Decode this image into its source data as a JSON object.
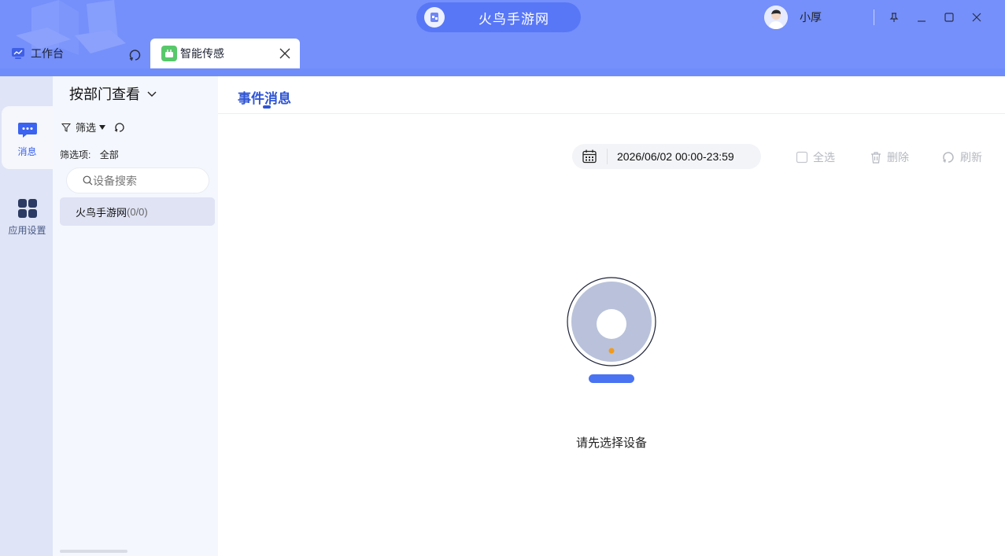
{
  "window": {
    "app_name": "火鸟手游网",
    "user_name": "小厚"
  },
  "tabs": [
    {
      "label": "工作台",
      "icon": "monitor-icon",
      "active": false
    },
    {
      "label": "智能传感",
      "icon": "sensor-app-icon",
      "active": true
    }
  ],
  "rail": {
    "items": [
      {
        "label": "消息",
        "icon": "message-icon",
        "active": true
      },
      {
        "label": "应用设置",
        "icon": "apps-grid-icon",
        "active": false
      }
    ]
  },
  "device_panel": {
    "group_by": "按部门查看",
    "filter_label": "筛选",
    "filter_items_label": "筛选项:",
    "filter_items_value": "全部",
    "search_placeholder": "设备搜索",
    "tree": [
      {
        "name": "火鸟手游网",
        "count": "(0/0)"
      }
    ]
  },
  "main": {
    "title": "事件消息",
    "date_range": "2026/06/02 00:00-23:59",
    "actions": {
      "select_all": "全选",
      "delete": "删除",
      "refresh": "刷新"
    },
    "empty_text": "请先选择设备"
  },
  "colors": {
    "titlebar": "#7590fb",
    "accent": "#2f55d4",
    "rail": "#dfe4f6",
    "panel": "#f4f7fd"
  }
}
